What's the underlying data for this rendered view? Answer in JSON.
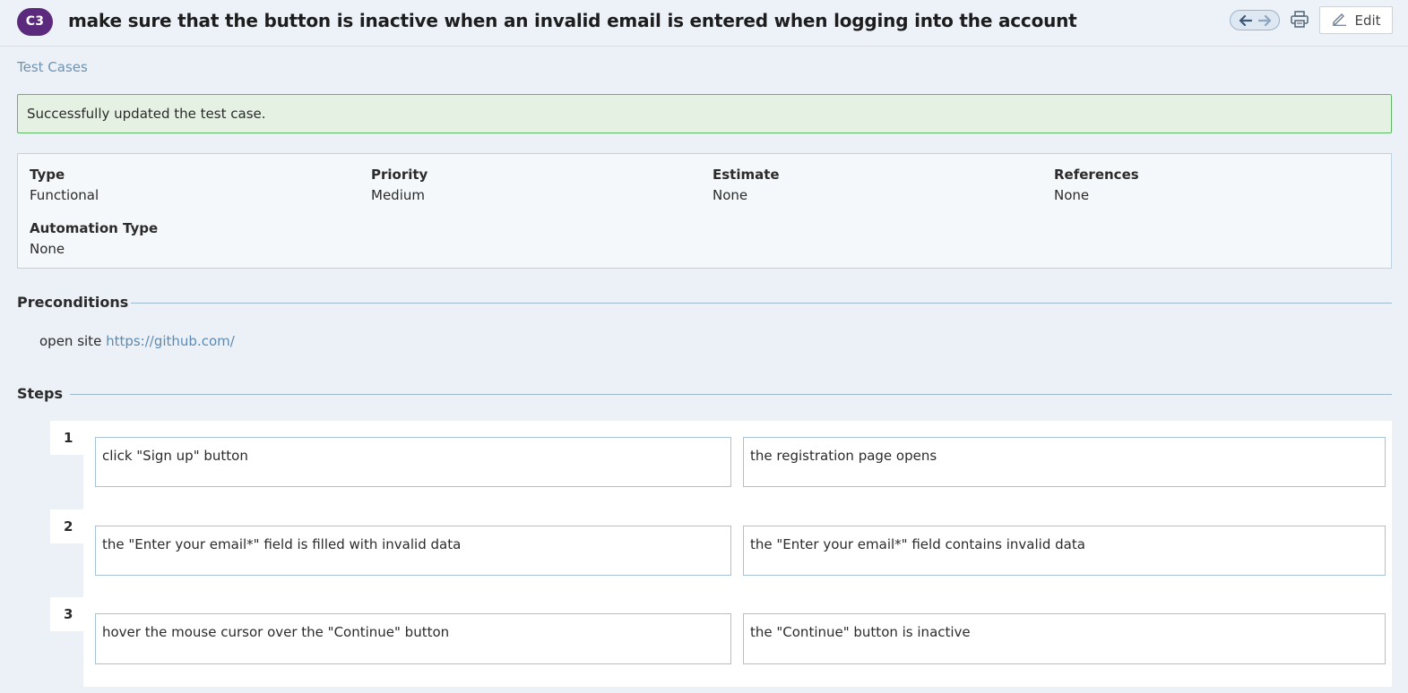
{
  "header": {
    "case_id": "C3",
    "title": "make sure that the button is inactive when an invalid email is entered when logging into the account",
    "edit_label": "Edit"
  },
  "breadcrumb": "Test Cases",
  "alert": "Successfully updated the test case.",
  "info": {
    "type": {
      "label": "Type",
      "value": "Functional"
    },
    "priority": {
      "label": "Priority",
      "value": "Medium"
    },
    "estimate": {
      "label": "Estimate",
      "value": "None"
    },
    "references": {
      "label": "References",
      "value": "None"
    },
    "automation_type": {
      "label": "Automation Type",
      "value": "None"
    }
  },
  "preconditions": {
    "title": "Preconditions",
    "text": "open site",
    "link": "https://github.com/"
  },
  "steps": {
    "title": "Steps",
    "items": [
      {
        "num": "1",
        "action": "click \"Sign up\" button",
        "expected": "the registration page opens"
      },
      {
        "num": "2",
        "action": "the \"Enter your email*\" field is filled with invalid data",
        "expected": "the \"Enter your email*\" field contains invalid data"
      },
      {
        "num": "3",
        "action": "hover the mouse cursor over the \"Continue\" button",
        "expected": "the \"Continue\" button is inactive"
      }
    ]
  },
  "colors": {
    "accent": "#5b2a7c",
    "success_border": "#5fb865",
    "success_bg": "#e5f1e2",
    "link": "#5d8ab4"
  },
  "icons": [
    "arrow-left-icon",
    "arrow-right-icon",
    "print-icon",
    "pencil-icon"
  ]
}
